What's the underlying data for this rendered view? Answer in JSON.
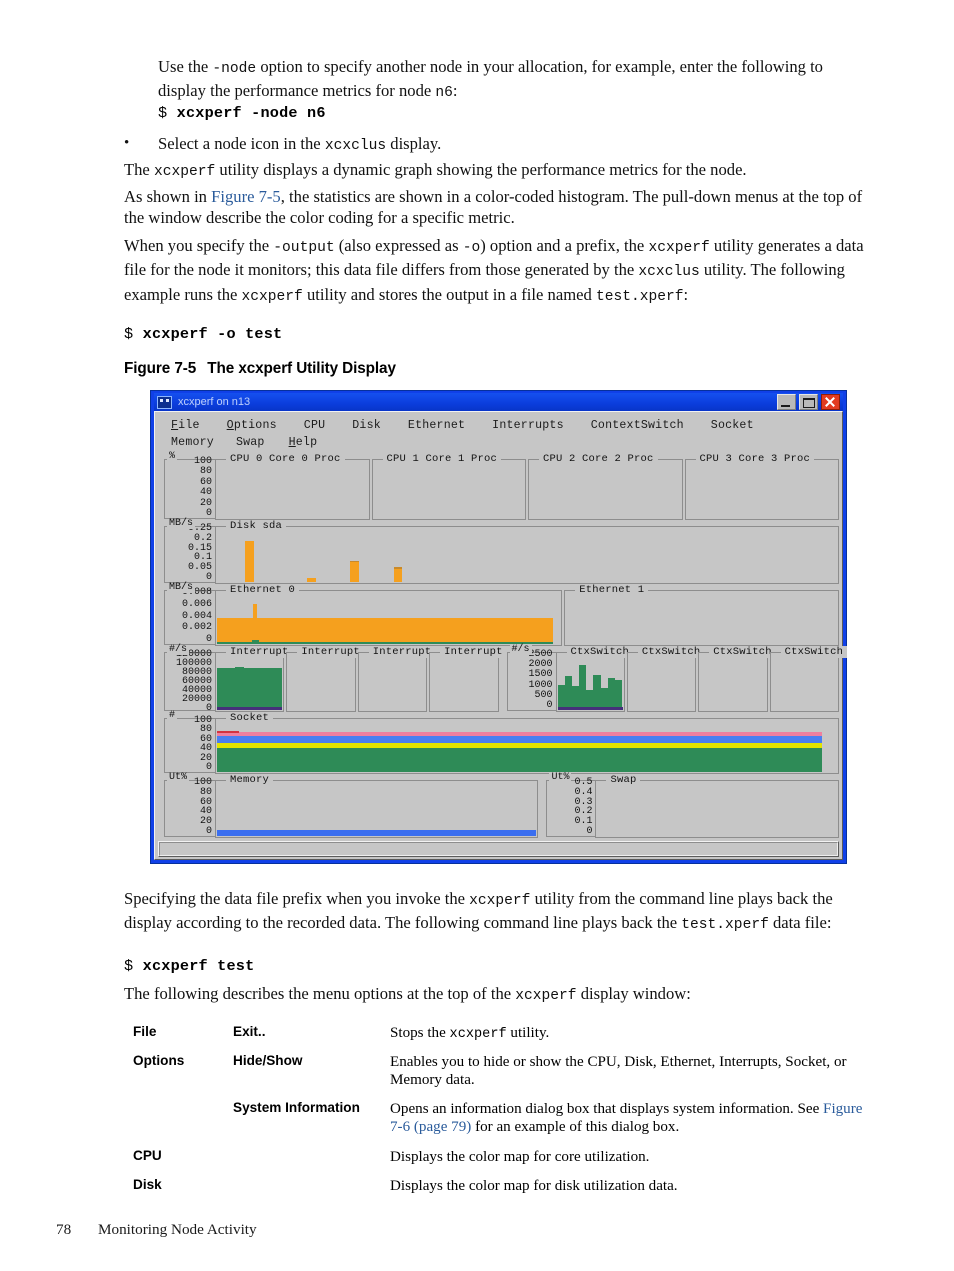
{
  "document": {
    "paragraphs": {
      "p1_line": "Use the -node option to specify another node in your allocation, for example, enter the following to display the performance metrics for node n6:",
      "p1_pre": "Use the ",
      "p1_code": "-node",
      "p1_post": " option to specify another node in your allocation, for example, enter the following to display the performance metrics for node ",
      "p1_code2": "n6",
      "p1_end": ":",
      "cmd1_prompt": "$",
      "cmd1": "xcxperf -node n6",
      "bullet_dot": "•",
      "bullet_pre": "Select a node icon in the ",
      "bullet_code": "xcxclus",
      "bullet_post": " display.",
      "p2_pre": "The ",
      "p2_code": "xcxperf",
      "p2_post": " utility displays a dynamic graph showing the performance metrics for the node.",
      "p3_pre": "As shown in ",
      "p3_link": "Figure 7-5",
      "p3_post": ", the statistics are shown in a color-coded histogram. The pull-down menus at the top of the window describe the color coding for a specific metric.",
      "p4_a": "When you specify the ",
      "p4_c1": "-output",
      "p4_b": " (also expressed as ",
      "p4_c2": "-o",
      "p4_c": ") option and a prefix, the ",
      "p4_c3": "xcxperf",
      "p4_d": " utility generates a data file for the node it monitors; this data file differs from those generated by the ",
      "p4_c4": "xcxclus",
      "p4_e": " utility. The following example runs the ",
      "p4_c5": "xcxperf",
      "p4_f": " utility and stores the output in a file named ",
      "p4_c6": "test.xperf",
      "p4_g": ":",
      "cmd2_prompt": "$",
      "cmd2": "xcxperf -o test",
      "p5_a": "Specifying the data file prefix when you invoke the ",
      "p5_c1": "xcxperf",
      "p5_b": " utility from the command line plays back the display according to the recorded data. The following command line plays back the ",
      "p5_c2": "test.xperf",
      "p5_c": " data file:",
      "cmd3_prompt": "$",
      "cmd3": "xcxperf test",
      "p6_a": "The following describes the menu options at the top of the ",
      "p6_c1": "xcxperf",
      "p6_b": " display window:"
    },
    "figure": {
      "label": "Figure",
      "number": "7-5",
      "title": "The xcxperf Utility Display"
    },
    "footer": {
      "page_number": "78",
      "section": "Monitoring Node Activity"
    }
  },
  "xcxperf_window": {
    "title": "xcxperf on n13",
    "window_buttons": {
      "minimize": "minimize-icon",
      "maximize": "maximize-icon",
      "close": "close-icon"
    },
    "menubar": {
      "row1": [
        "File",
        "Options",
        "CPU",
        "Disk",
        "Ethernet",
        "Interrupts",
        "ContextSwitch",
        "Socket"
      ],
      "row2": [
        "Memory",
        "Swap",
        "Help"
      ]
    },
    "status_bar_text": ""
  },
  "chart_data": [
    {
      "type": "bar",
      "title": "CPU",
      "ylabel": "%",
      "ylim": [
        0,
        100
      ],
      "tick_labels": [
        "100",
        "80",
        "60",
        "40",
        "20",
        "0"
      ],
      "panels": [
        {
          "title": "CPU 0 Core 0 Proc",
          "values": []
        },
        {
          "title": "CPU 1 Core 1 Proc",
          "values": []
        },
        {
          "title": "CPU 2 Core 2 Proc",
          "values": []
        },
        {
          "title": "CPU 3 Core 3 Proc",
          "values": []
        }
      ]
    },
    {
      "type": "bar",
      "title": "Disk sda",
      "ylabel": "MB/s",
      "ylim": [
        0,
        0.25
      ],
      "tick_labels": [
        "0.25",
        "0.2",
        "0.15",
        "0.1",
        "0.05",
        "0"
      ],
      "color": "#f5a01e",
      "panels": [
        {
          "title": "Disk sda",
          "bars": [
            {
              "x": 0.045,
              "value": 0.21
            },
            {
              "x": 0.145,
              "value": 0.022
            },
            {
              "x": 0.215,
              "value": 0.105
            },
            {
              "x": 0.285,
              "value": 0.072
            }
          ]
        }
      ]
    },
    {
      "type": "area",
      "title": "Ethernet",
      "ylabel": "MB/s",
      "ylim": [
        0,
        0.008
      ],
      "tick_labels": [
        "0.008",
        "0.006",
        "0.004",
        "0.002",
        "0"
      ],
      "colors": {
        "in": "#f5a01e",
        "out": "#2e8b57"
      },
      "panels": [
        {
          "title": "Ethernet 0",
          "baseline": 0.0042,
          "spike_x": 0.105,
          "spike_value": 0.0068,
          "fill_extent": 0.795,
          "green_base": 0.0004
        },
        {
          "title": "Ethernet 1",
          "baseline": 0,
          "fill_extent": 0
        }
      ]
    },
    {
      "type": "bar",
      "title": "Interrupts",
      "ylabel": "#/s",
      "ylim": [
        0,
        120000
      ],
      "tick_labels": [
        "120000",
        "100000",
        "80000",
        "60000",
        "40000",
        "20000",
        "0"
      ],
      "color": "#2e8b57",
      "panels": [
        {
          "title": "Interrupt",
          "level": 99000,
          "extent": 1.0
        },
        {
          "title": "Interrupt",
          "level": 0,
          "extent": 0
        },
        {
          "title": "Interrupt",
          "level": 0,
          "extent": 0
        },
        {
          "title": "Interrupt",
          "level": 0,
          "extent": 0
        }
      ]
    },
    {
      "type": "bar",
      "title": "ContextSwitch",
      "ylabel": "#/s",
      "ylim": [
        0,
        2500
      ],
      "tick_labels": [
        "2500",
        "2000",
        "1500",
        "1000",
        "500",
        "0"
      ],
      "color": "#2e8b57",
      "panels": [
        {
          "title": "CtxSwitch",
          "values": [
            1250,
            1650,
            1200,
            2200,
            1000,
            1700,
            1100,
            1550,
            1450
          ]
        },
        {
          "title": "CtxSwitch",
          "values": []
        },
        {
          "title": "CtxSwitch",
          "values": []
        },
        {
          "title": "CtxSwitch",
          "values": []
        }
      ]
    },
    {
      "type": "area",
      "title": "Socket",
      "ylabel": "#",
      "ylim": [
        0,
        100
      ],
      "tick_labels": [
        "100",
        "80",
        "60",
        "40",
        "20",
        "0"
      ],
      "stack": [
        {
          "name": "green",
          "color": "#2e8b57",
          "value": 47
        },
        {
          "name": "yellow",
          "color": "#e3e300",
          "value": 6
        },
        {
          "name": "blue",
          "color": "#4a7ef0",
          "value": 9
        },
        {
          "name": "pink",
          "color": "#ef7f9e",
          "value": 6
        }
      ],
      "fill_extent": 0.975
    },
    {
      "type": "area",
      "title": "Memory",
      "ylabel": "Ut%",
      "ylim": [
        0,
        100
      ],
      "tick_labels": [
        "100",
        "80",
        "60",
        "40",
        "20",
        "0"
      ],
      "color": "#3a6ef0",
      "panels": [
        {
          "title": "Memory",
          "value": 9,
          "fill_extent": 1.0
        }
      ]
    },
    {
      "type": "area",
      "title": "Swap",
      "ylabel": "Ut%",
      "ylim": [
        0,
        0.5
      ],
      "tick_labels": [
        "0.5",
        "0.4",
        "0.3",
        "0.2",
        "0.1",
        "0"
      ],
      "panels": [
        {
          "title": "Swap",
          "value": 0,
          "fill_extent": 0
        }
      ]
    }
  ],
  "options_table": {
    "rows": [
      {
        "menu": "File",
        "item": "Exit..",
        "desc_pre": "Stops the ",
        "desc_code": "xcxperf",
        "desc_post": " utility.",
        "link": "",
        "desc_post2": ""
      },
      {
        "menu": "Options",
        "item": "Hide/Show",
        "desc_pre": "Enables you to hide or show the CPU, Disk, Ethernet, Interrupts, Socket, or Memory data.",
        "desc_code": "",
        "desc_post": "",
        "link": "",
        "desc_post2": ""
      },
      {
        "menu": "",
        "item": "System Information",
        "desc_pre": "Opens an information dialog box that displays system information. See ",
        "desc_code": "",
        "desc_post": "",
        "link": "Figure 7-6 (page 79)",
        "desc_post2": " for an example of this dialog box."
      },
      {
        "menu": "CPU",
        "item": "",
        "desc_pre": "Displays the color map for core utilization.",
        "desc_code": "",
        "desc_post": "",
        "link": "",
        "desc_post2": ""
      },
      {
        "menu": "Disk",
        "item": "",
        "desc_pre": "Displays the color map for disk utilization data.",
        "desc_code": "",
        "desc_post": "",
        "link": "",
        "desc_post2": ""
      }
    ]
  }
}
